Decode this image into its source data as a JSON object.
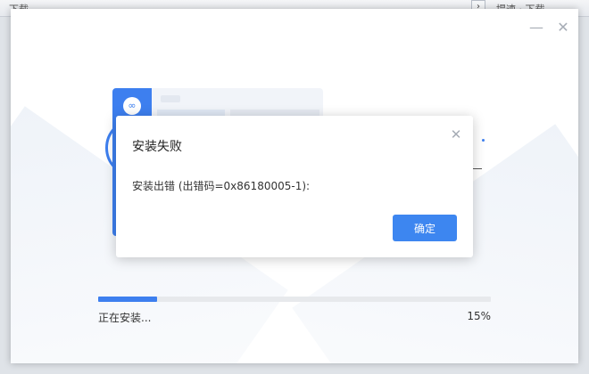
{
  "background": {
    "left_text": "下载",
    "right_text": "提速 · 下载",
    "scroll_glyph": "›"
  },
  "installer": {
    "minimize_glyph": "—",
    "close_glyph": "✕",
    "illustration_logo_glyph": "∞",
    "progress": {
      "label": "正在安装...",
      "percent_text": "15%",
      "value": 0.15
    }
  },
  "dialog": {
    "title": "安装失败",
    "message": "安装出错 (出错码=0x86180005-1):",
    "ok_label": "确定",
    "close_glyph": "✕"
  },
  "colors": {
    "accent": "#3d7fef",
    "button": "#3d86f0"
  }
}
